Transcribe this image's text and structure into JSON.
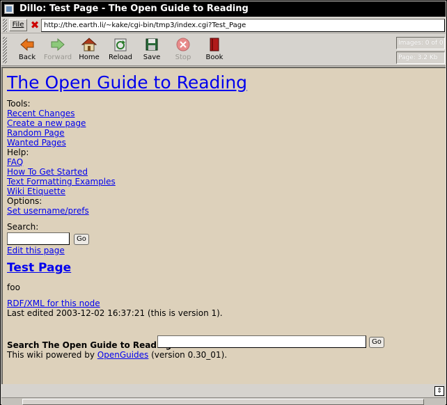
{
  "window": {
    "title": "Dillo: Test Page - The Open Guide to Reading"
  },
  "urlbar": {
    "file_label": "File",
    "url": "http://the.earth.li/~kake/cgi-bin/tmp3/index.cgi?Test_Page"
  },
  "toolbar": {
    "buttons": [
      {
        "label": "Back",
        "icon": "back-arrow-icon",
        "enabled": true
      },
      {
        "label": "Forward",
        "icon": "forward-arrow-icon",
        "enabled": false
      },
      {
        "label": "Home",
        "icon": "home-icon",
        "enabled": true
      },
      {
        "label": "Reload",
        "icon": "reload-icon",
        "enabled": true
      },
      {
        "label": "Save",
        "icon": "save-icon",
        "enabled": true
      },
      {
        "label": "Stop",
        "icon": "stop-icon",
        "enabled": false
      },
      {
        "label": "Book",
        "icon": "bookmark-icon",
        "enabled": true
      }
    ],
    "status_images": "Images: 0 of 0",
    "status_page": "Page: 3.2 Kb"
  },
  "page": {
    "site_title": "The Open Guide to Reading",
    "tools_label": "Tools:",
    "tools_links": [
      "Recent Changes",
      "Create a new page",
      "Random Page",
      "Wanted Pages"
    ],
    "help_label": "Help:",
    "help_links": [
      "FAQ",
      "How To Get Started",
      "Text Formatting Examples",
      "Wiki Etiquette"
    ],
    "options_label": "Options:",
    "options_links": [
      "Set username/prefs"
    ],
    "search_label": "Search:",
    "search_value": "",
    "go_label": "Go",
    "edit_link": "Edit this page",
    "page_title": "Test Page",
    "body_text": "foo",
    "rdf_link": "RDF/XML for this node",
    "last_edited": "Last edited 2003-12-02 16:37:21 (this is version 1).",
    "bottom_search_label": "Search The Open Guide to Reading:",
    "bottom_search_value": "",
    "bottom_go_label": "Go",
    "powered_prefix": "This wiki powered by ",
    "powered_link": "OpenGuides",
    "powered_suffix": " (version 0.30_01)."
  },
  "colors": {
    "page_background": "#ddd1bb",
    "link": "#0000ee",
    "chrome": "#d6d3ce",
    "titlebar": "#000000"
  }
}
